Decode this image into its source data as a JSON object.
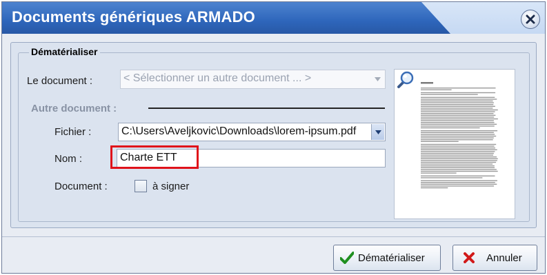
{
  "window": {
    "title": "Documents génériques ARMADO"
  },
  "section": {
    "legend": "Dématérialiser"
  },
  "document_row": {
    "label": "Le document :",
    "selected": "< Sélectionner un autre document ... >"
  },
  "other_document": {
    "heading": "Autre document :"
  },
  "fichier": {
    "label": "Fichier :",
    "value": "C:\\Users\\Aveljkovic\\Downloads\\lorem-ipsum.pdf"
  },
  "nom": {
    "label": "Nom :",
    "value": "Charte ETT"
  },
  "signature": {
    "label": "Document :",
    "checkbox_label": "à signer",
    "checked": false
  },
  "preview": {
    "page_title": "Lorem ipsum"
  },
  "buttons": {
    "dematerialiser": "Dématérialiser",
    "annuler": "Annuler"
  },
  "icons": {
    "close": "close-icon",
    "check": "checkmark-icon",
    "cancel": "cross-icon",
    "zoom": "magnifier-icon",
    "dropdown": "chevron-down-icon"
  },
  "colors": {
    "title_bar": "#2e66bb",
    "highlight": "#e0121a",
    "check_green": "#1f8f1f",
    "cross_red": "#d11a1a"
  }
}
